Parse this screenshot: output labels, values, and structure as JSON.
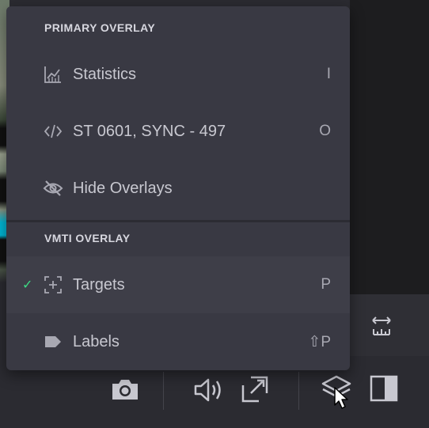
{
  "primary_overlay": {
    "title": "PRIMARY OVERLAY",
    "items": [
      {
        "label": "Statistics",
        "shortcut": "I",
        "icon": "chart-icon",
        "checked": false
      },
      {
        "label": "ST 0601, SYNC - 497",
        "shortcut": "O",
        "icon": "code-icon",
        "checked": false
      },
      {
        "label": "Hide Overlays",
        "shortcut": "",
        "icon": "eye-off-icon",
        "checked": false
      }
    ]
  },
  "vmti_overlay": {
    "title": "VMTI OVERLAY",
    "items": [
      {
        "label": "Targets",
        "shortcut": "P",
        "icon": "target-icon",
        "checked": true,
        "check_mark": "✓"
      },
      {
        "label": "Labels",
        "shortcut": "⇧P",
        "icon": "label-tag-icon",
        "checked": false
      }
    ]
  },
  "bottom_toolbar": {
    "icons": [
      "camera-icon",
      "volume-icon",
      "expand-icon",
      "layers-icon",
      "panel-toggle-icon",
      "measure-width-icon"
    ]
  },
  "colors": {
    "menu_bg": "#393943",
    "check": "#3ddc84",
    "text": "#c8c8d0"
  }
}
